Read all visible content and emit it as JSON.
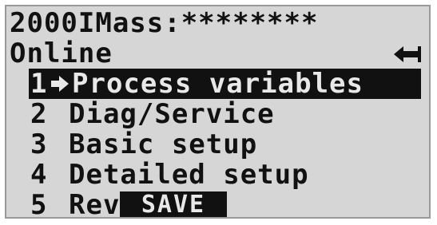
{
  "header": {
    "device_line": "2000IMass:********",
    "status": "Online",
    "back_icon": "back-arrow-icon"
  },
  "menu": {
    "items": [
      {
        "number": "1",
        "label": "Process variables",
        "selected": true
      },
      {
        "number": "2",
        "label": "Diag/Service",
        "selected": false
      },
      {
        "number": "3",
        "label": "Basic setup",
        "selected": false
      },
      {
        "number": "4",
        "label": "Detailed setup",
        "selected": false
      },
      {
        "number": "5",
        "label": "Review",
        "selected": false
      }
    ]
  },
  "softkeys": {
    "save_label": "SAVE"
  },
  "colors": {
    "lcd_background": "#d6d6d6",
    "pixel_dark": "#111111"
  }
}
